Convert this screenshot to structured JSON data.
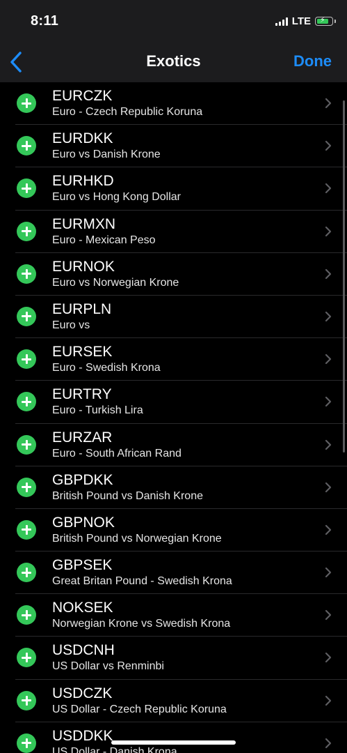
{
  "status_bar": {
    "time": "8:11",
    "network": "LTE"
  },
  "nav": {
    "title": "Exotics",
    "done_label": "Done"
  },
  "colors": {
    "accent": "#1d8cf8",
    "add_green": "#34c759",
    "background": "#000000",
    "bar_background": "#1c1c1e"
  },
  "items": [
    {
      "symbol": "EURCZK",
      "description": "Euro - Czech Republic Koruna"
    },
    {
      "symbol": "EURDKK",
      "description": "Euro vs Danish Krone"
    },
    {
      "symbol": "EURHKD",
      "description": "Euro vs Hong Kong Dollar"
    },
    {
      "symbol": "EURMXN",
      "description": "Euro - Mexican Peso"
    },
    {
      "symbol": "EURNOK",
      "description": "Euro vs Norwegian Krone"
    },
    {
      "symbol": "EURPLN",
      "description": "Euro vs"
    },
    {
      "symbol": "EURSEK",
      "description": "Euro - Swedish Krona"
    },
    {
      "symbol": "EURTRY",
      "description": "Euro - Turkish Lira"
    },
    {
      "symbol": "EURZAR",
      "description": "Euro - South African Rand"
    },
    {
      "symbol": "GBPDKK",
      "description": "British Pound vs Danish Krone"
    },
    {
      "symbol": "GBPNOK",
      "description": "British Pound vs Norwegian Krone"
    },
    {
      "symbol": "GBPSEK",
      "description": "Great Britan Pound - Swedish Krona"
    },
    {
      "symbol": "NOKSEK",
      "description": "Norwegian Krone vs Swedish Krona"
    },
    {
      "symbol": "USDCNH",
      "description": "US Dollar vs Renminbi"
    },
    {
      "symbol": "USDCZK",
      "description": "US Dollar - Czech Republic Koruna"
    },
    {
      "symbol": "USDDKK",
      "description": "US Dollar - Danish Krona"
    }
  ]
}
